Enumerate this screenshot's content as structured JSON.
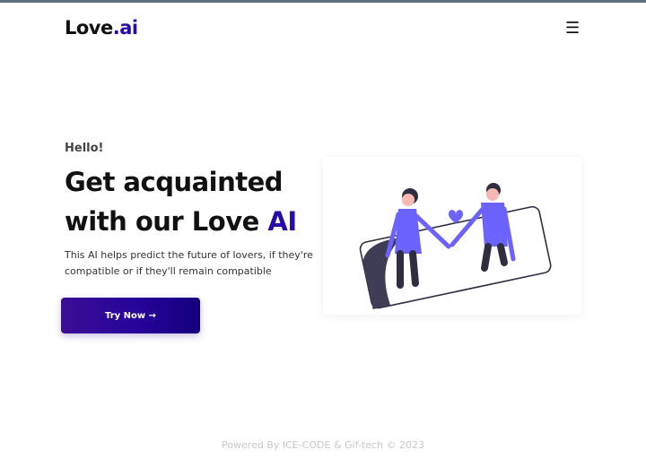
{
  "header": {
    "logo_text": "Love",
    "logo_accent": ".ai",
    "menu_icon": "☰"
  },
  "hero": {
    "greeting": "Hello!",
    "title_line1": "Get acquainted",
    "title_line2_prefix": "with our Love ",
    "title_accent": "AI",
    "description": "This AI helps predict the future of lovers, if they're compatible or if they'll remain compatible",
    "cta_label": "Try Now →",
    "illustration": "couple-holding-hands-heart"
  },
  "footer": {
    "credit": "Powered By ICE-CODE & Gif-tech © 2023"
  },
  "colors": {
    "accent": "#2a0aa8",
    "button_gradient_start": "#3a0f95",
    "button_gradient_end": "#14007c",
    "figure_purple": "#6c63ff",
    "dark": "#2f2e41"
  }
}
